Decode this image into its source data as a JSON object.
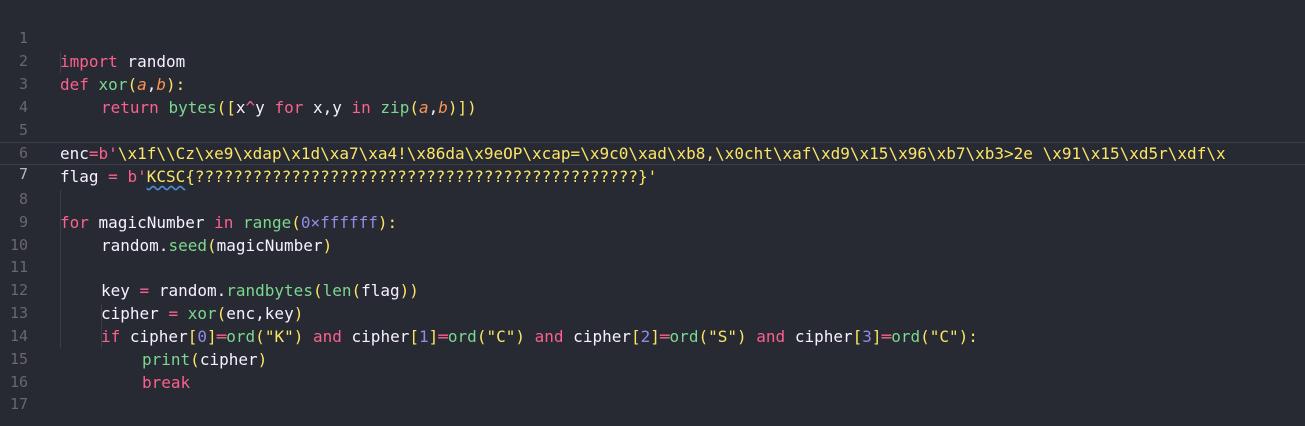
{
  "editor": {
    "background": "#272a32",
    "current_line": 7,
    "line_numbers": [
      "1",
      "2",
      "3",
      "4",
      "5",
      "6",
      "7",
      "8",
      "9",
      "10",
      "11",
      "12",
      "13",
      "14",
      "15",
      "16",
      "17"
    ],
    "lines": {
      "l1": [
        "import",
        " random"
      ],
      "l2": [
        "def",
        " ",
        "xor",
        "(",
        "a",
        ",",
        "b",
        "):"
      ],
      "l3": [
        "return",
        " ",
        "bytes",
        "([",
        "x",
        "^",
        "y",
        " ",
        "for",
        " x,y ",
        "in",
        " ",
        "zip",
        "(",
        "a",
        ",",
        "b",
        ")])"
      ],
      "l5": [
        "enc",
        "=",
        "b'",
        "\\x1f\\\\Cz\\xe9\\xdap\\x1d\\xa7\\xa4!\\x86da\\x9eOP\\xcap=\\x9c0\\xad\\xb8,\\x0cht\\xaf\\xd9\\x15\\x96\\xb7\\xb3>2e \\x91\\x15\\xd5r\\xdf\\x"
      ],
      "l6": [
        "flag",
        " ",
        "=",
        " ",
        "b'",
        "KCSC",
        "{??????????????????????????????????????????????}'"
      ],
      "l8": [
        "for",
        " magicNumber ",
        "in",
        " ",
        "range",
        "(",
        "0×ffffff",
        "):"
      ],
      "l9": [
        "random.",
        "seed",
        "(",
        "magicNumber",
        ")"
      ],
      "l11": [
        "key",
        " ",
        "=",
        " random.",
        "randbytes",
        "(",
        "len",
        "(",
        "flag",
        "))"
      ],
      "l12": [
        "cipher",
        " ",
        "=",
        " ",
        "xor",
        "(",
        "enc,key",
        ")"
      ],
      "l13": [
        "if",
        " cipher",
        "[",
        "0",
        "]",
        "═",
        "ord",
        "(",
        "\"K\"",
        ")",
        " ",
        "and",
        " cipher",
        "[",
        "1",
        "]",
        "═",
        "ord",
        "(",
        "\"C\"",
        ")",
        " ",
        "and",
        " cipher",
        "[",
        "2",
        "]",
        "═",
        "ord",
        "(",
        "\"S\"",
        ")",
        " ",
        "and",
        " cipher",
        "[",
        "3",
        "]",
        "═",
        "ord",
        "(",
        "\"C\"",
        "):"
      ],
      "l14": [
        "print",
        "(",
        "cipher",
        ")"
      ],
      "l15": [
        "break"
      ]
    }
  },
  "colors": {
    "keyword": "#fc618d",
    "function": "#7bd88f",
    "parameter": "#fd9353",
    "number": "#948ae3",
    "string": "#fce566",
    "text": "#f7f1ff",
    "gutter": "#69676c"
  }
}
